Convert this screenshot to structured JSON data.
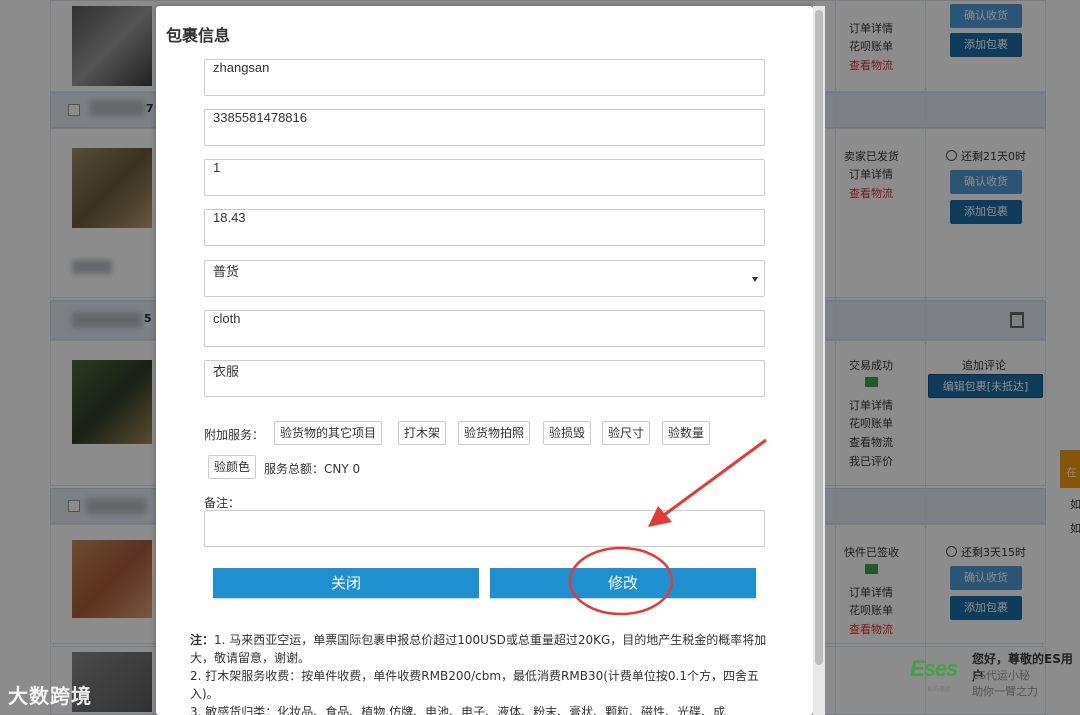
{
  "background": {
    "rows": [
      {
        "status_lines": [
          "订单详情",
          "花呗账单"
        ],
        "logistics_link": "查看物流",
        "buttons": [
          "确认收货",
          "添加包裹"
        ]
      },
      {
        "order_no": "7",
        "status": "卖家已发货",
        "status_lines": [
          "订单详情"
        ],
        "logistics_link": "查看物流",
        "countdown": "还剩21天0时",
        "buttons": [
          "确认收货",
          "添加包裹"
        ]
      },
      {
        "order_no": "5",
        "status": "交易成功",
        "status_lines": [
          "订单详情",
          "花呗账单",
          "查看物流",
          "我已评价"
        ],
        "add_review": "追加评论",
        "edit_button": "编辑包裹[未抵达]"
      },
      {
        "status": "快件已签收",
        "status_lines": [
          "订单详情",
          "花呗账单"
        ],
        "logistics_link": "查看物流",
        "countdown": "还剩3天15时",
        "buttons": [
          "确认收货",
          "添加包裹"
        ]
      }
    ],
    "side_tab": "在",
    "side_items": [
      "如",
      "如"
    ],
    "es_widget": {
      "logo": "Eses",
      "logo_sub": "易购速运",
      "greeting": "您好，尊敬的ES用户",
      "line1": "ES代运小秘",
      "line2": "助你一臂之力"
    },
    "watermark": "大数跨境"
  },
  "modal": {
    "title": "包裹信息",
    "fields": {
      "name": "zhangsan",
      "tracking_no": "3385581478816",
      "quantity": "1",
      "value": "18.43",
      "cargo_type": "普货",
      "name_en": "cloth",
      "name_cn": "衣服"
    },
    "services_label": "附加服务：",
    "services": [
      "验货物的其它项目",
      "打木架",
      "验货物拍照",
      "验损毁",
      "验尺寸",
      "验数量",
      "验颜色"
    ],
    "service_total": "服务总额：CNY 0",
    "remark_label": "备注：",
    "remark_value": "",
    "close_button": "关闭",
    "modify_button": "修改",
    "notes": {
      "prefix": "注：",
      "line1": "1. 马来西亚空运，单票国际包裹申报总价超过100USD或总重量超过20KG，目的地产生税金的概率将加大，敬请留意，谢谢。",
      "line2": "2. 打木架服务收费：按单件收费，单件收费RMB200/cbm，最低消费RMB30(计费单位按0.1个方，四舍五入)。",
      "line3": "3. 敏感货归类：化妆品、食品、植物,仿牌、电池、电子、液体、粉末、膏状、颗粒、磁性、光碟、成"
    }
  },
  "annotation_color": "#e53935"
}
